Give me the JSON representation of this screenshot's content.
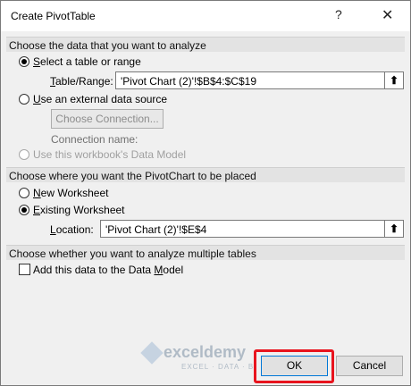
{
  "window": {
    "title": "Create PivotTable",
    "help_icon": "?",
    "close_icon": "✕"
  },
  "section_data": {
    "heading": "Choose the data that you want to analyze"
  },
  "select_table": {
    "label_u": "S",
    "label_rest": "elect a table or range",
    "selected": true
  },
  "table_range": {
    "label_u": "T",
    "label_rest": "able/Range:",
    "value": "'Pivot Chart (2)'!$B$4:$C$19"
  },
  "external_source": {
    "label_u": "U",
    "label_rest": "se an external data source",
    "selected": false
  },
  "choose_connection": {
    "label": "Choose Connection..."
  },
  "connection_name": {
    "label": "Connection name:"
  },
  "data_model_source": {
    "label": "Use this workbook's Data Model",
    "selected": false,
    "disabled": true
  },
  "section_place": {
    "heading": "Choose where you want the PivotChart to be placed"
  },
  "new_worksheet": {
    "label_u": "N",
    "label_rest": "ew Worksheet",
    "selected": false
  },
  "existing_worksheet": {
    "label_u": "E",
    "label_rest": "xisting Worksheet",
    "selected": true
  },
  "location": {
    "label_u": "L",
    "label_rest": "ocation:",
    "value": "'Pivot Chart (2)'!$E$4"
  },
  "section_multi": {
    "heading": "Choose whether you want to analyze multiple tables"
  },
  "add_data_model": {
    "label_pre": "Add this data to the Data ",
    "label_u": "M",
    "label_rest": "odel",
    "checked": false
  },
  "watermark": {
    "name": "exceldemy",
    "tagline": "EXCEL · DATA · BI"
  },
  "buttons": {
    "ok": "OK",
    "cancel": "Cancel"
  },
  "collapse_icon": "⬆",
  "colors": {
    "highlight": "#e8141e",
    "dialog_bg": "#f0f0f0"
  }
}
